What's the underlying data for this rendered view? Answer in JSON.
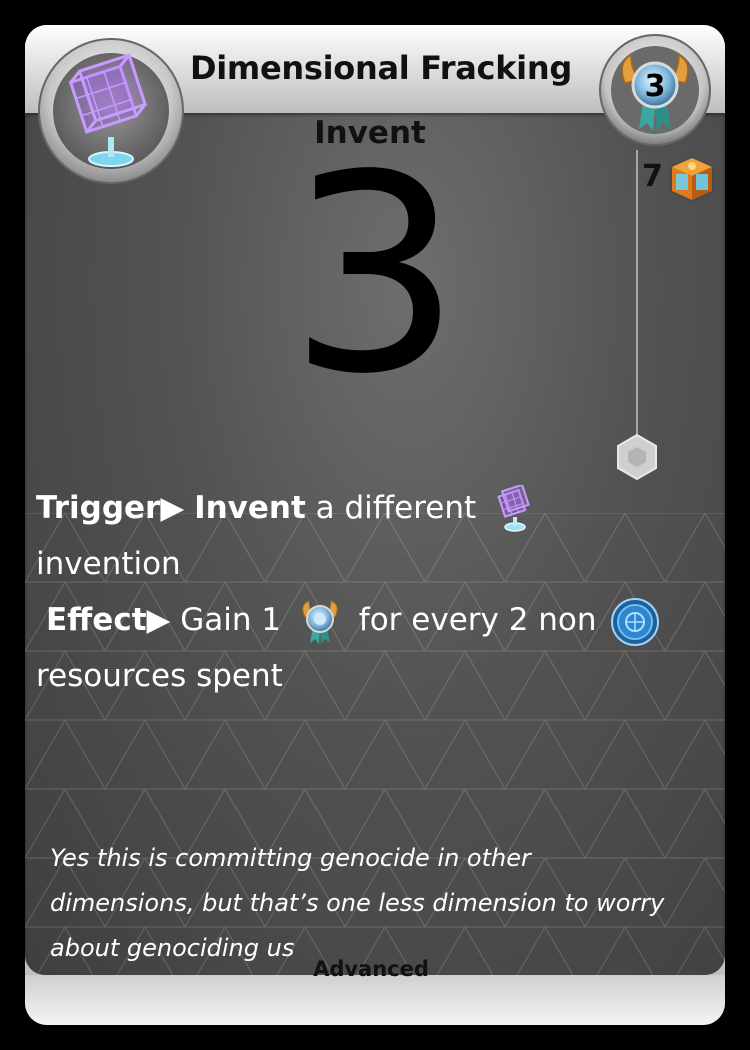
{
  "card": {
    "title": "Dimensional Fracking",
    "type_label": "Invent",
    "invent_value": "3",
    "tier": "3",
    "cost": "7",
    "footer": "Advanced",
    "icons": {
      "card_icon": "hypercube-icon",
      "tier_badge": "tier-medal-icon",
      "cost_icon": "resource-crate-icon",
      "track_marker": "hexagon-marker-icon"
    }
  },
  "rules": {
    "trigger_label": "Trigger",
    "trigger_arrow": "▶",
    "trigger_verb": "Invent",
    "trigger_text_a": "a different",
    "trigger_icon": "hypercube-icon",
    "trigger_text_b": "invention",
    "effect_label": "Effect",
    "effect_arrow": "▶",
    "effect_text_a": "Gain 1",
    "effect_icon_1": "medal-icon",
    "effect_text_b": "for every 2 non",
    "effect_icon_2": "blue-token-icon",
    "effect_text_c": "resources spent"
  },
  "flavor": {
    "text": "Yes this is committing genocide in other dimensions, but that’s one less dimension to worry about genociding us"
  },
  "colors": {
    "panel": "#525252",
    "text_light": "#ffffff",
    "text_dark": "#111111",
    "accent_purple": "#b47cff",
    "accent_blue": "#3a8fd6",
    "accent_orange": "#e07a1e"
  }
}
